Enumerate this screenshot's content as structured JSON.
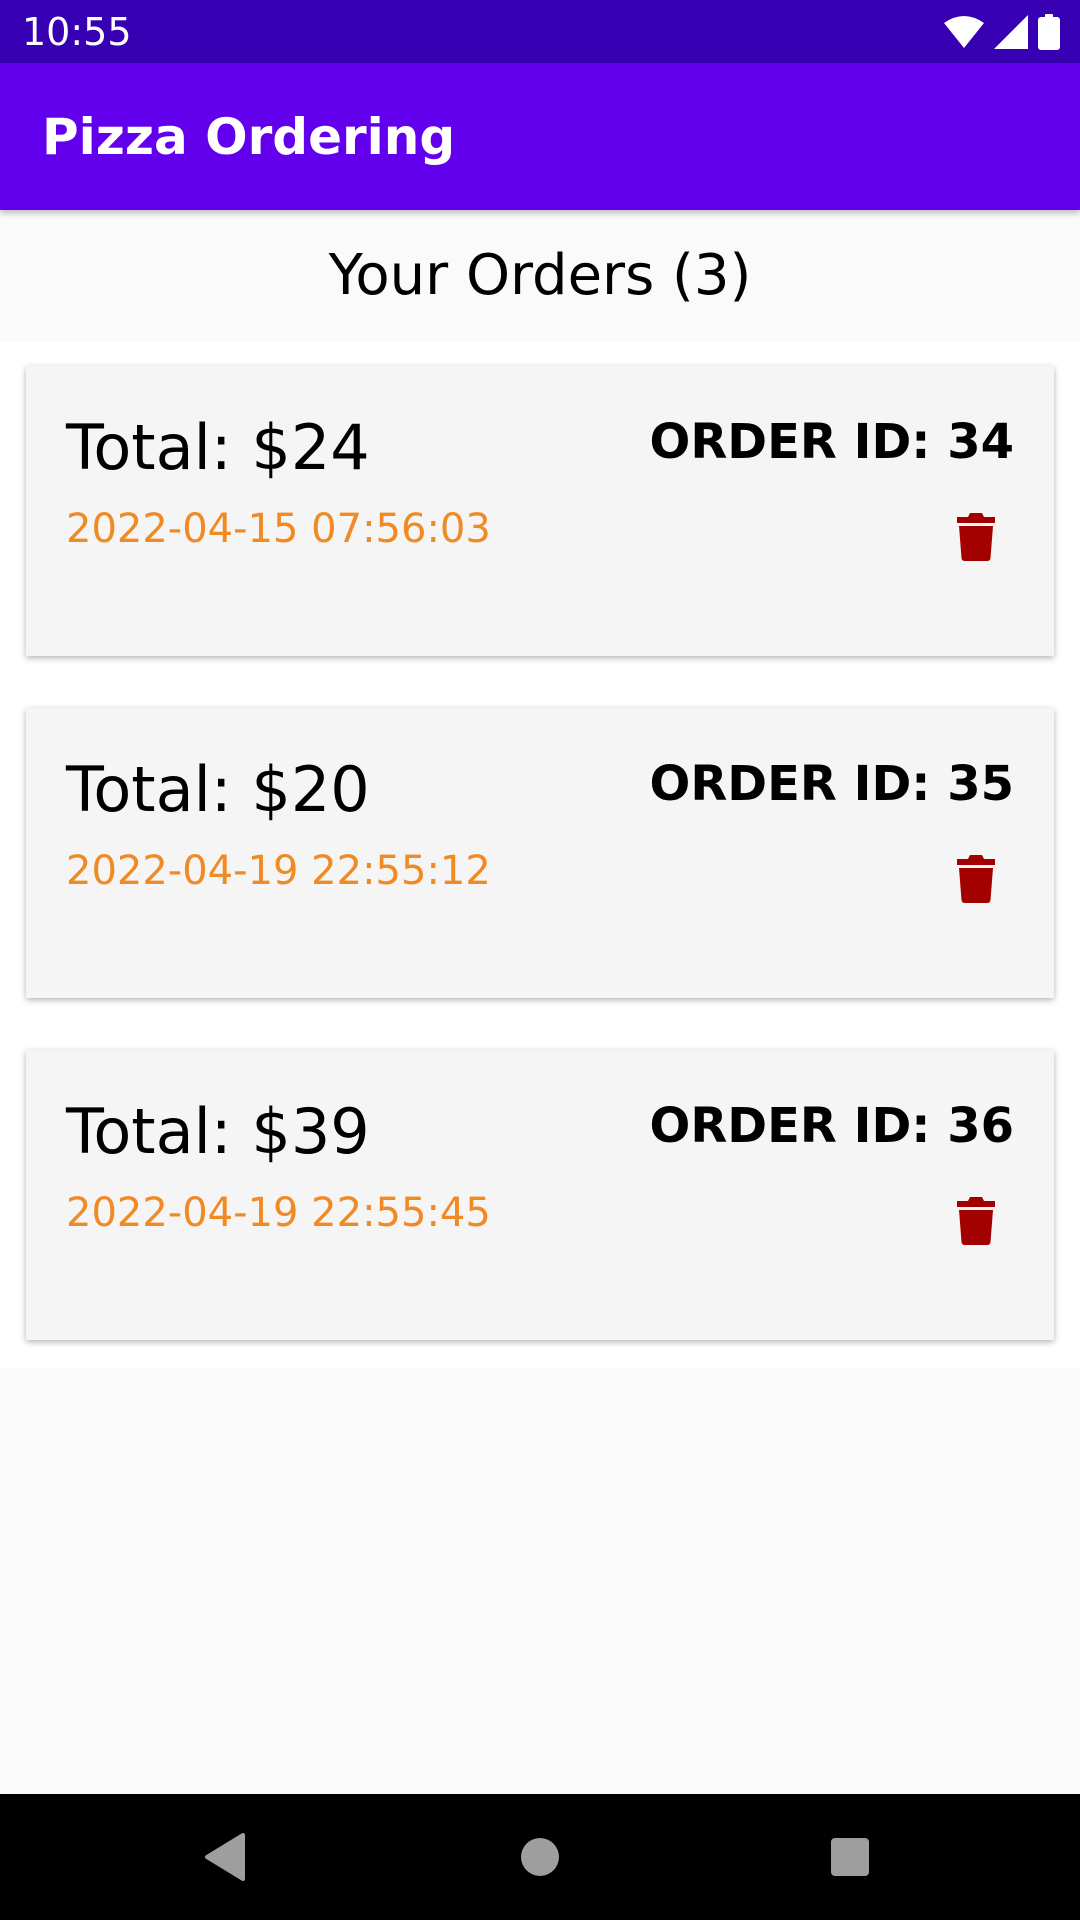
{
  "status_bar": {
    "time": "10:55",
    "icons": [
      "wifi-icon",
      "signal-icon",
      "battery-icon"
    ]
  },
  "app_bar": {
    "title": "Pizza Ordering",
    "color": "#6200ee",
    "status_color": "#3700b3"
  },
  "main": {
    "heading": "Your Orders (3)",
    "orders": [
      {
        "total": "Total: $24",
        "date": "2022-04-15 07:56:03",
        "order_id": "ORDER ID: 34"
      },
      {
        "total": "Total: $20",
        "date": "2022-04-19 22:55:12",
        "order_id": "ORDER ID: 35"
      },
      {
        "total": "Total: $39",
        "date": "2022-04-19 22:55:45",
        "order_id": "ORDER ID: 36"
      }
    ]
  },
  "colors": {
    "date_text": "#f08a24",
    "delete_icon": "#a30000"
  },
  "nav_bar": {
    "icons": [
      "back-icon",
      "home-icon",
      "recents-icon"
    ]
  }
}
